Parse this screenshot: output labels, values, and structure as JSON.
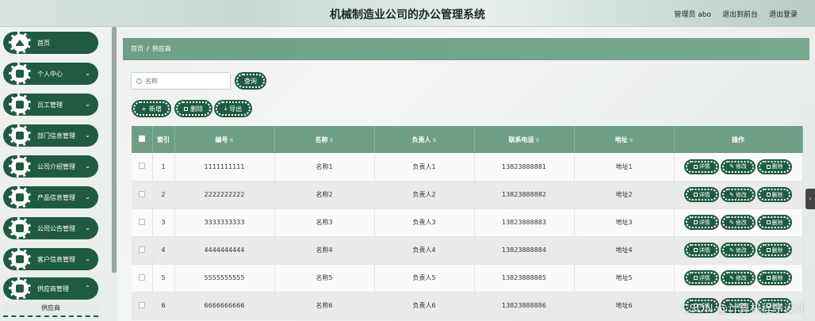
{
  "header": {
    "title": "机械制造业公司的办公管理系统",
    "admin_label": "管理员 abo",
    "front_label": "退出到前台",
    "logout_label": "退出登录"
  },
  "sidebar": {
    "items": [
      {
        "label": "首页",
        "icon": "home-icon"
      },
      {
        "label": "个人中心",
        "icon": "user-icon"
      },
      {
        "label": "员工管理",
        "icon": "grid-icon"
      },
      {
        "label": "部门信息管理",
        "icon": "grid-icon"
      },
      {
        "label": "公司介绍管理",
        "icon": "grid-icon"
      },
      {
        "label": "产品信息管理",
        "icon": "grid-icon"
      },
      {
        "label": "公司公告管理",
        "icon": "grid-icon"
      },
      {
        "label": "客户信息管理",
        "icon": "grid-icon"
      },
      {
        "label": "供应商管理",
        "icon": "grid-icon"
      }
    ],
    "active_sub": "供应商"
  },
  "breadcrumb": {
    "home": "首页",
    "sep": "/",
    "current": "供应商"
  },
  "search": {
    "placeholder": "名称",
    "button": "查询"
  },
  "actions": {
    "add": "新增",
    "delete": "删除",
    "export": "导出"
  },
  "table": {
    "columns": [
      "索引",
      "编号",
      "名称",
      "负责人",
      "联系电话",
      "地址",
      "操作"
    ],
    "rows": [
      {
        "idx": "1",
        "code": "1111111111",
        "name": "名称1",
        "owner": "负责人1",
        "phone": "13823888881",
        "addr": "地址1"
      },
      {
        "idx": "2",
        "code": "2222222222",
        "name": "名称2",
        "owner": "负责人2",
        "phone": "13823888882",
        "addr": "地址2"
      },
      {
        "idx": "3",
        "code": "3333333333",
        "name": "名称3",
        "owner": "负责人3",
        "phone": "13823888883",
        "addr": "地址3"
      },
      {
        "idx": "4",
        "code": "4444444444",
        "name": "名称4",
        "owner": "负责人4",
        "phone": "13823888884",
        "addr": "地址4"
      },
      {
        "idx": "5",
        "code": "5555555555",
        "name": "名称5",
        "owner": "负责人5",
        "phone": "13823888885",
        "addr": "地址5"
      },
      {
        "idx": "6",
        "code": "6666666666",
        "name": "名称6",
        "owner": "负责人6",
        "phone": "13823888886",
        "addr": "地址6"
      }
    ],
    "op_labels": {
      "detail": "详情",
      "edit": "修改",
      "delete": "删除"
    }
  },
  "watermark": "CSDN @计算机程序设计"
}
